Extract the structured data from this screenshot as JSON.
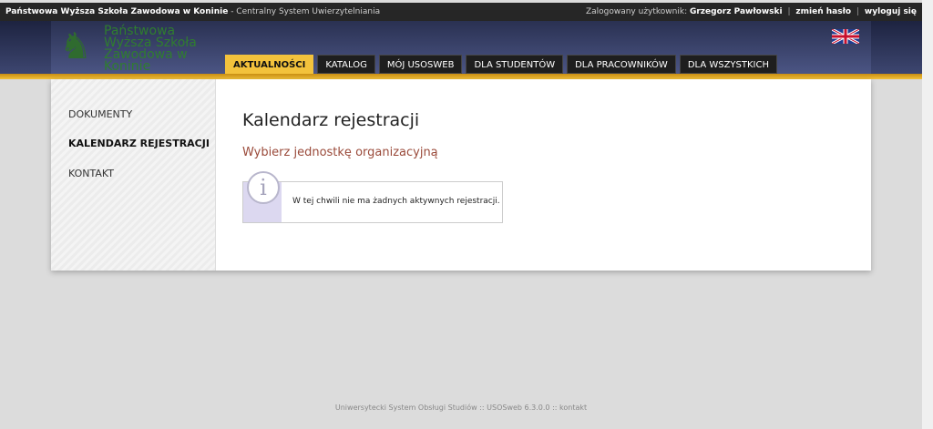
{
  "topbar": {
    "institution": "Państwowa Wyższa Szkoła Zawodowa w Koninie",
    "system": " - Centralny System Uwierzytelniania",
    "logged_label": "Zalogowany użytkownik:",
    "user": "Grzegorz Pawłowski",
    "change_password": "zmień hasło",
    "logout": "wyloguj się"
  },
  "logo": {
    "text": "Państwowa Wyższa Szkoła Zawodowa w Koninie"
  },
  "nav": {
    "items": [
      "AKTUALNOŚCI",
      "KATALOG",
      "MÓJ USOSWEB",
      "DLA STUDENTÓW",
      "DLA PRACOWNIKÓW",
      "DLA WSZYSTKICH"
    ],
    "active": 0
  },
  "sidebar": {
    "items": [
      "DOKUMENTY",
      "KALENDARZ REJESTRACJI",
      "KONTAKT"
    ],
    "active": 1
  },
  "content": {
    "title": "Kalendarz rejestracji",
    "subtitle": "Wybierz jednostkę organizacyjną",
    "info_message": "W tej chwili nie ma żadnych aktywnych rejestracji."
  },
  "footer": {
    "text": "Uniwersytecki System Obsługi Studiów :: USOSweb 6.3.0.0 :: kontakt"
  },
  "colors": {
    "topbar": "#262626",
    "header": "#2a3152",
    "accent_gold": "#f3c23c",
    "subtitle": "#9a4a3a"
  }
}
